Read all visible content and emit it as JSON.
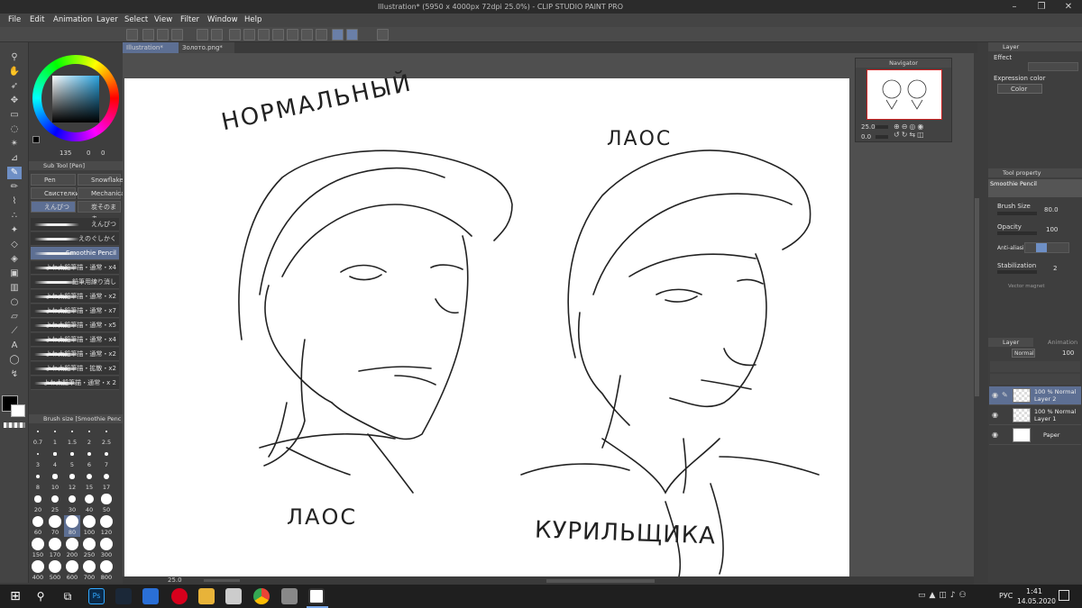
{
  "app": {
    "title": "Illustration* (5950 x 4000px 72dpi 25.0%) - CLIP STUDIO PAINT PRO"
  },
  "menu": [
    "File",
    "Edit",
    "Animation",
    "Layer",
    "Select",
    "View",
    "Filter",
    "Window",
    "Help"
  ],
  "doc_tabs": [
    "Illustration*",
    "Золото.png*"
  ],
  "sub_tool": {
    "header": "Sub Tool [Pen]",
    "tabs": [
      "Pen",
      "Snowflakes",
      "Свистелки",
      "Mechanica",
      "えんぴつ",
      "炭そのまま"
    ],
    "brushes": [
      "えんぴつ",
      "えのぐしかく",
      "Smoothie Pencil",
      "よわ太鉛筆描・通常・x4",
      "鉛筆用練り消し",
      "よわ太鉛筆描・通常・x2",
      "よわ太鉛筆描・通常・x7",
      "よわ太鉛筆描・通常・x5",
      "よわ太鉛筆描・通常・x4",
      "よわ太鉛筆描・通常・x2",
      "よわ太鉛筆描・拡散・x2",
      "よわ太鉛筆描・通常・x 2"
    ]
  },
  "color": {
    "readout": "135",
    "v1": "0",
    "v2": "0",
    "main": "#000000",
    "sub": "#ffffff"
  },
  "brush_size": {
    "header": "Brush size [Smoothie Penc",
    "sizes": [
      "0.7",
      "1",
      "1.5",
      "2",
      "2.5",
      "3",
      "4",
      "5",
      "6",
      "7",
      "8",
      "10",
      "12",
      "15",
      "17",
      "20",
      "25",
      "30",
      "40",
      "50",
      "60",
      "70",
      "80",
      "100",
      "120",
      "150",
      "170",
      "200",
      "250",
      "300",
      "400",
      "500",
      "600",
      "700",
      "800"
    ],
    "selected": "80"
  },
  "navigator": {
    "title": "Navigator",
    "zoom": "25.0",
    "angle": "0.0"
  },
  "canvas_text": [
    "НОРМАЛЬНЫЙ",
    "ЛАОС",
    "ЛАОС",
    "КУРИЛЬЩИКА"
  ],
  "layer_property": {
    "tab": "Layer",
    "effect": "Effect",
    "expression_color": "Expression color",
    "color_value": "Color"
  },
  "tool_property": {
    "tab": "Tool property",
    "brush": "Smoothie Pencil",
    "brush_size_label": "Brush Size",
    "brush_size_value": "80.0",
    "opacity_label": "Opacity",
    "opacity_value": "100",
    "anti_alias_label": "Anti-aliasing",
    "stabilization_label": "Stabilization",
    "stabilization_value": "2",
    "vector_label": "Vector magnet"
  },
  "layers_panel": {
    "tab": "Layer",
    "tab2": "Animation",
    "blend": "Normal",
    "opacity": "100",
    "layers": [
      {
        "line1": "100 % Normal",
        "line2": "Layer 2",
        "selected": true
      },
      {
        "line1": "100 % Normal",
        "line2": "Layer 1",
        "selected": false
      },
      {
        "line1": "",
        "line2": "Paper",
        "selected": false
      }
    ]
  },
  "status": {
    "zoom": "25.0"
  },
  "taskbar": {
    "time": "1:41",
    "date": "14.05.2020",
    "lang": "РУС"
  },
  "accent": "#6e8fc5"
}
